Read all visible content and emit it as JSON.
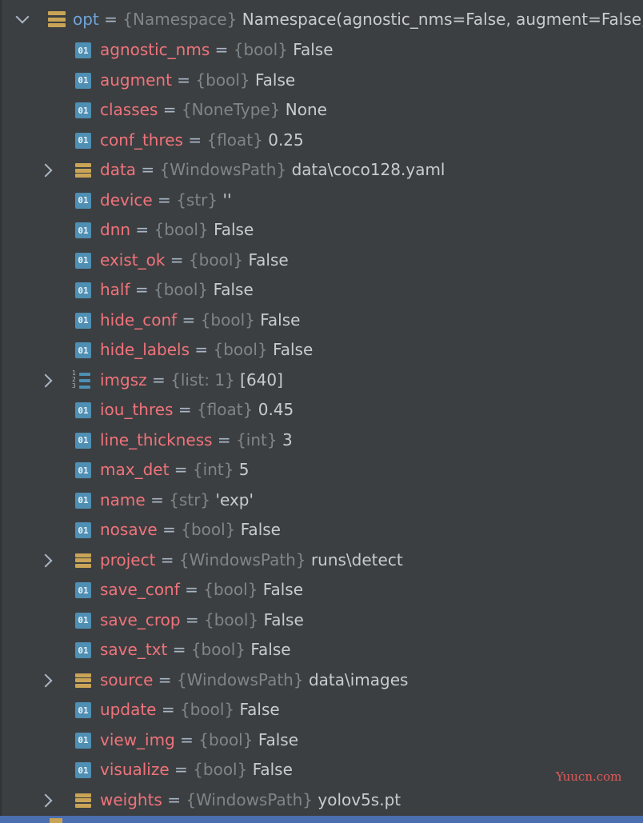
{
  "root": {
    "name": "opt",
    "type": "{Namespace}",
    "value": "Namespace(agnostic_nms=False, augment=False,",
    "expanded": true
  },
  "items": [
    {
      "name": "agnostic_nms",
      "type": "{bool}",
      "value": "False",
      "icon": "primitive-icon",
      "expandable": false
    },
    {
      "name": "augment",
      "type": "{bool}",
      "value": "False",
      "icon": "primitive-icon",
      "expandable": false
    },
    {
      "name": "classes",
      "type": "{NoneType}",
      "value": "None",
      "icon": "primitive-icon",
      "expandable": false
    },
    {
      "name": "conf_thres",
      "type": "{float}",
      "value": "0.25",
      "icon": "primitive-icon",
      "expandable": false
    },
    {
      "name": "data",
      "type": "{WindowsPath}",
      "value": "data\\coco128.yaml",
      "icon": "object-icon",
      "expandable": true
    },
    {
      "name": "device",
      "type": "{str}",
      "value": "''",
      "icon": "primitive-icon",
      "expandable": false
    },
    {
      "name": "dnn",
      "type": "{bool}",
      "value": "False",
      "icon": "primitive-icon",
      "expandable": false
    },
    {
      "name": "exist_ok",
      "type": "{bool}",
      "value": "False",
      "icon": "primitive-icon",
      "expandable": false
    },
    {
      "name": "half",
      "type": "{bool}",
      "value": "False",
      "icon": "primitive-icon",
      "expandable": false
    },
    {
      "name": "hide_conf",
      "type": "{bool}",
      "value": "False",
      "icon": "primitive-icon",
      "expandable": false
    },
    {
      "name": "hide_labels",
      "type": "{bool}",
      "value": "False",
      "icon": "primitive-icon",
      "expandable": false
    },
    {
      "name": "imgsz",
      "type": "{list: 1}",
      "value": "[640]",
      "icon": "list-icon",
      "expandable": true
    },
    {
      "name": "iou_thres",
      "type": "{float}",
      "value": "0.45",
      "icon": "primitive-icon",
      "expandable": false
    },
    {
      "name": "line_thickness",
      "type": "{int}",
      "value": "3",
      "icon": "primitive-icon",
      "expandable": false
    },
    {
      "name": "max_det",
      "type": "{int}",
      "value": "5",
      "icon": "primitive-icon",
      "expandable": false
    },
    {
      "name": "name",
      "type": "{str}",
      "value": "'exp'",
      "icon": "primitive-icon",
      "expandable": false
    },
    {
      "name": "nosave",
      "type": "{bool}",
      "value": "False",
      "icon": "primitive-icon",
      "expandable": false
    },
    {
      "name": "project",
      "type": "{WindowsPath}",
      "value": "runs\\detect",
      "icon": "object-icon",
      "expandable": true
    },
    {
      "name": "save_conf",
      "type": "{bool}",
      "value": "False",
      "icon": "primitive-icon",
      "expandable": false
    },
    {
      "name": "save_crop",
      "type": "{bool}",
      "value": "False",
      "icon": "primitive-icon",
      "expandable": false
    },
    {
      "name": "save_txt",
      "type": "{bool}",
      "value": "False",
      "icon": "primitive-icon",
      "expandable": false
    },
    {
      "name": "source",
      "type": "{WindowsPath}",
      "value": "data\\images",
      "icon": "object-icon",
      "expandable": true
    },
    {
      "name": "update",
      "type": "{bool}",
      "value": "False",
      "icon": "primitive-icon",
      "expandable": false
    },
    {
      "name": "view_img",
      "type": "{bool}",
      "value": "False",
      "icon": "primitive-icon",
      "expandable": false
    },
    {
      "name": "visualize",
      "type": "{bool}",
      "value": "False",
      "icon": "primitive-icon",
      "expandable": false
    },
    {
      "name": "weights",
      "type": "{WindowsPath}",
      "value": "yolov5s.pt",
      "icon": "object-icon",
      "expandable": true
    }
  ],
  "icon_badge_text": "01",
  "list_icon_digits": "123",
  "watermark": "Yuucn.com",
  "colors": {
    "background": "#3c3f41",
    "variable_name": "#f0737b",
    "root_name": "#6fa3d8",
    "type_hint": "#7f8588",
    "value": "#c8ccd0",
    "primitive_icon": "#4e8fb3",
    "object_icon": "#c9a457",
    "selection_bar": "#4b6eaf"
  }
}
